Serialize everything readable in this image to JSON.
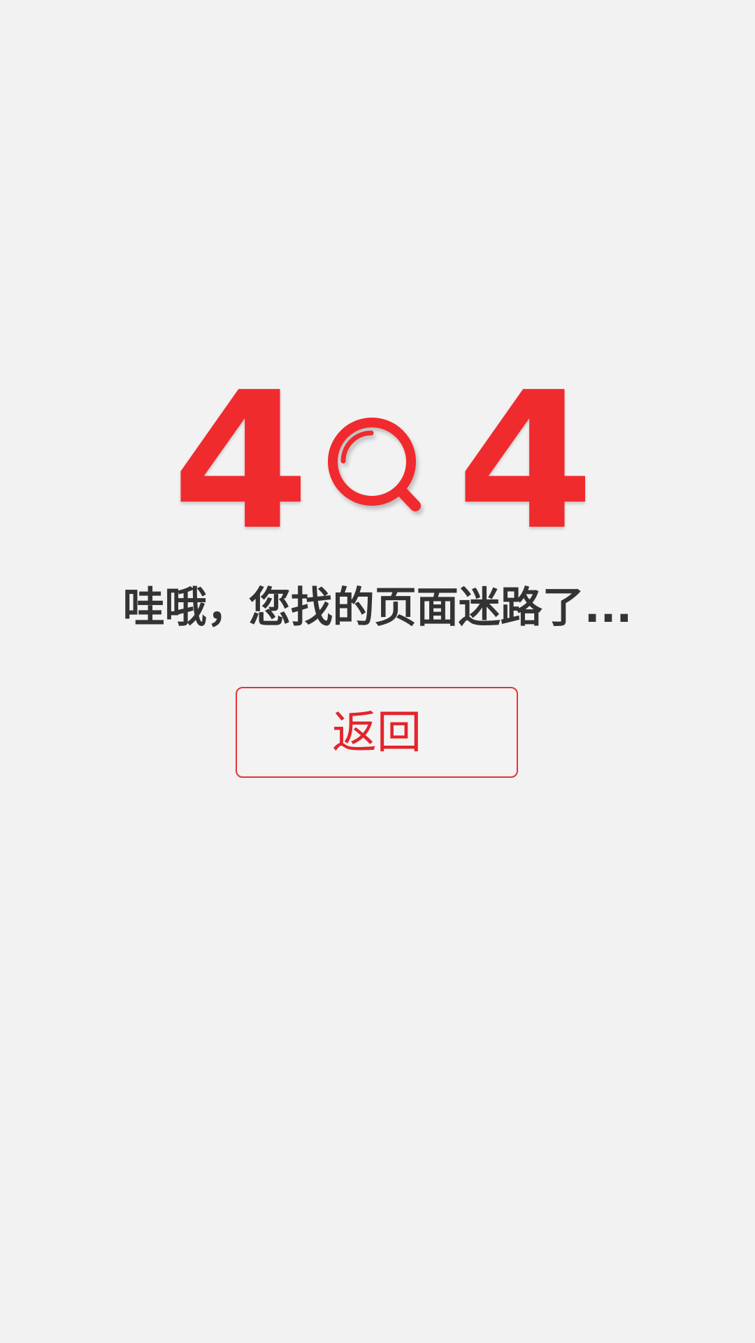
{
  "error": {
    "code_left": "4",
    "code_right": "4",
    "icon": "magnifier-icon",
    "message": "哇哦，您找的页面迷路了...",
    "back_button_label": "返回"
  },
  "colors": {
    "background": "#f2f2f2",
    "accent": "#f02b2e",
    "text": "#333333"
  }
}
